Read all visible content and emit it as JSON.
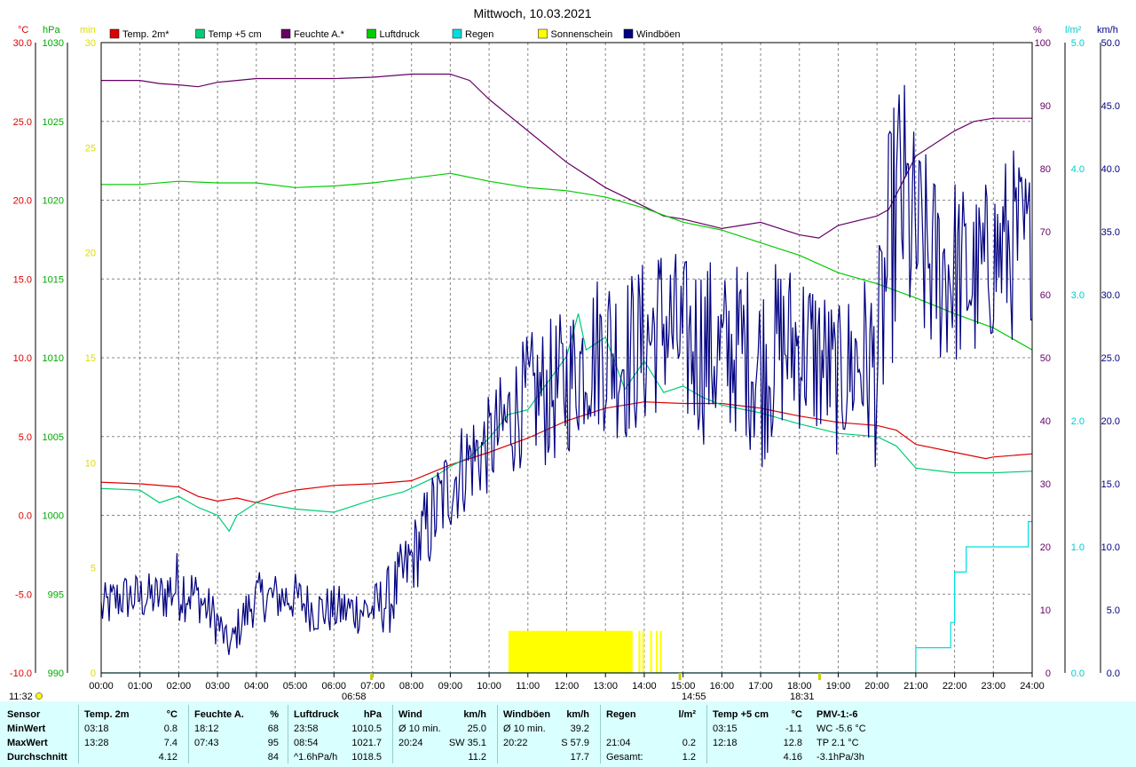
{
  "title": "Mittwoch, 10.03.2021",
  "axes": {
    "temp_unit": "°C",
    "pressure_unit": "hPa",
    "sun_unit": "min",
    "humidity_unit": "%",
    "rain_unit": "l/m²",
    "wind_unit": "km/h",
    "temp_ticks": [
      "30.0",
      "25.0",
      "20.0",
      "15.0",
      "10.0",
      "5.0",
      "0.0",
      "-5.0",
      "-10.0"
    ],
    "pressure_ticks": [
      "1030",
      "1025",
      "1020",
      "1015",
      "1010",
      "1005",
      "1000",
      "995",
      "990"
    ],
    "sun_ticks": [
      "30",
      "25",
      "20",
      "15",
      "10",
      "5",
      "0"
    ],
    "humidity_ticks": [
      "100",
      "90",
      "80",
      "70",
      "60",
      "50",
      "40",
      "30",
      "20",
      "10",
      "0"
    ],
    "rain_ticks": [
      "5.0",
      "4.0",
      "3.0",
      "2.0",
      "1.0",
      "0.0"
    ],
    "wind_ticks": [
      "50.0",
      "45.0",
      "40.0",
      "35.0",
      "30.0",
      "25.0",
      "20.0",
      "15.0",
      "10.0",
      "5.0",
      "0.0"
    ],
    "x_ticks": [
      "00:00",
      "01:00",
      "02:00",
      "03:00",
      "04:00",
      "05:00",
      "06:00",
      "07:00",
      "08:00",
      "09:00",
      "10:00",
      "11:00",
      "12:00",
      "13:00",
      "14:00",
      "15:00",
      "16:00",
      "17:00",
      "18:00",
      "19:00",
      "20:00",
      "21:00",
      "22:00",
      "23:00",
      "24:00"
    ]
  },
  "legend": [
    {
      "label": "Temp. 2m*",
      "color": "#dd0000"
    },
    {
      "label": "Temp +5 cm",
      "color": "#00cc77"
    },
    {
      "label": "Feuchte A.*",
      "color": "#660066"
    },
    {
      "label": "Luftdruck",
      "color": "#00cc00"
    },
    {
      "label": "Regen",
      "color": "#00dddd"
    },
    {
      "label": "Sonnenschein",
      "color": "#ffff00"
    },
    {
      "label": "Windböen",
      "color": "#000080"
    }
  ],
  "markers": {
    "corner_time": "11:32",
    "sunrise": "06:58",
    "noon": "14:55",
    "sunset": "18:31"
  },
  "chart_data": {
    "type": "line",
    "x_unit": "hour",
    "xlim": [
      0,
      24
    ],
    "series": [
      {
        "name": "Temp. 2m*",
        "axis": "temp",
        "ylim": [
          -10,
          30
        ],
        "color": "#dd0000",
        "x": [
          0,
          1,
          2,
          2.5,
          3,
          3.5,
          4,
          4.5,
          5,
          6,
          7,
          8,
          9,
          10,
          11,
          12,
          13,
          14,
          15,
          16,
          17,
          18,
          19,
          20,
          20.5,
          21,
          22,
          22.8,
          23,
          24
        ],
        "y": [
          2.1,
          2.0,
          1.8,
          1.2,
          0.9,
          1.1,
          0.8,
          1.3,
          1.6,
          1.9,
          2.0,
          2.2,
          3.2,
          4.0,
          4.9,
          6.0,
          6.8,
          7.2,
          7.1,
          7.1,
          6.8,
          6.3,
          5.9,
          5.7,
          5.4,
          4.5,
          4.0,
          3.6,
          3.7,
          3.9
        ]
      },
      {
        "name": "Temp +5 cm",
        "axis": "temp",
        "ylim": [
          -10,
          30
        ],
        "color": "#00cc77",
        "x": [
          0,
          1,
          1.5,
          2,
          2.5,
          3,
          3.3,
          3.5,
          4,
          5,
          6,
          7,
          7.8,
          8.5,
          9,
          9.5,
          10,
          10.5,
          11,
          11.5,
          12,
          12.3,
          12.5,
          13,
          13.5,
          14,
          14.5,
          15,
          15.5,
          16,
          17,
          18,
          19,
          20,
          20.5,
          21,
          22,
          23,
          24
        ],
        "y": [
          1.7,
          1.6,
          0.8,
          1.2,
          0.5,
          0,
          -1.0,
          0,
          0.8,
          0.4,
          0.2,
          1.0,
          1.5,
          2.3,
          3.1,
          3.7,
          4.9,
          6.4,
          6.7,
          8.4,
          10.1,
          12.8,
          10.5,
          11.3,
          8.0,
          9.8,
          7.8,
          8.2,
          7.5,
          7.0,
          6.5,
          5.8,
          5.2,
          5.0,
          4.4,
          3.0,
          2.7,
          2.7,
          2.8
        ]
      },
      {
        "name": "Feuchte A.*",
        "axis": "humidity",
        "ylim": [
          0,
          100
        ],
        "color": "#660066",
        "x": [
          0,
          1,
          1.5,
          2,
          2.5,
          3,
          3.5,
          4,
          5,
          6,
          7,
          8,
          9,
          9.5,
          10,
          11,
          12,
          13,
          14,
          14.5,
          15,
          16,
          16.5,
          17,
          18,
          18.5,
          19,
          20,
          20.3,
          21,
          22,
          22.5,
          23,
          24
        ],
        "y": [
          94,
          94,
          93.5,
          93.3,
          93,
          93.7,
          94,
          94.3,
          94.3,
          94.3,
          94.5,
          95,
          95,
          94,
          91,
          86,
          81,
          77,
          74,
          72.5,
          72,
          70.5,
          71,
          71.5,
          69.5,
          69,
          71,
          72.5,
          73.5,
          82,
          86,
          87.5,
          88,
          88
        ]
      },
      {
        "name": "Luftdruck",
        "axis": "pressure",
        "ylim": [
          990,
          1030
        ],
        "color": "#00cc00",
        "x": [
          0,
          1,
          2,
          3,
          4,
          5,
          6,
          7,
          8,
          9,
          10,
          11,
          12,
          13,
          14,
          15,
          16,
          17,
          18,
          19,
          20,
          21,
          22,
          23,
          24
        ],
        "y": [
          1021.0,
          1021.0,
          1021.2,
          1021.1,
          1021.1,
          1020.8,
          1020.9,
          1021.1,
          1021.4,
          1021.7,
          1021.2,
          1020.8,
          1020.6,
          1020.2,
          1019.5,
          1018.6,
          1018.1,
          1017.3,
          1016.5,
          1015.4,
          1014.7,
          1013.8,
          1012.8,
          1011.9,
          1010.5
        ]
      },
      {
        "name": "Regen",
        "axis": "rain",
        "ylim": [
          0,
          5
        ],
        "color": "#00dddd",
        "step": true,
        "x": [
          0,
          20.9,
          21,
          21.8,
          21.9,
          22.0,
          22.3,
          22.7,
          23.9,
          24
        ],
        "y": [
          0,
          0,
          0.2,
          0.2,
          0.4,
          0.8,
          1.0,
          1.0,
          1.2,
          1.2
        ]
      },
      {
        "name": "Windböen",
        "axis": "wind",
        "ylim": [
          0,
          50
        ],
        "color": "#000080",
        "noise": true,
        "x": [
          0,
          0.5,
          1,
          1.5,
          2,
          2.5,
          3,
          3.3,
          3.6,
          4,
          4.5,
          5,
          5.5,
          6,
          6.5,
          7,
          7.5,
          8,
          8.5,
          9,
          9.5,
          10,
          10.5,
          11,
          11.5,
          12,
          12.5,
          13,
          13.5,
          14,
          14.5,
          15,
          15.5,
          16,
          16.5,
          17,
          17.5,
          18,
          18.5,
          19,
          19.5,
          20,
          20.3,
          20.6,
          21,
          21.5,
          22,
          22.5,
          23,
          23.5,
          24
        ],
        "y": [
          5,
          6,
          6,
          6,
          7,
          6,
          4,
          2,
          4,
          6,
          6,
          6,
          5,
          5,
          5,
          5,
          6,
          9,
          12,
          15,
          17,
          18,
          20,
          22,
          22,
          23,
          25,
          26,
          25,
          26,
          28,
          26,
          26,
          25,
          26,
          24,
          26,
          26,
          25,
          23,
          25,
          24,
          33,
          38,
          34,
          32,
          32,
          31,
          33,
          34,
          34
        ],
        "amp": [
          2,
          2,
          2,
          2,
          3,
          2,
          2,
          1,
          2,
          2,
          2,
          2,
          2,
          2,
          2,
          2,
          3,
          3,
          4,
          4,
          4,
          4,
          5,
          5,
          6,
          6,
          6,
          7,
          7,
          7,
          7,
          7,
          8,
          7,
          7,
          8,
          7,
          7,
          7,
          6,
          7,
          8,
          10,
          11,
          9,
          8,
          8,
          7,
          7,
          8,
          6
        ]
      }
    ],
    "sunshine": {
      "axis": "sun",
      "ylim": [
        0,
        30
      ],
      "color": "#ffff00",
      "bars": [
        [
          10.5,
          13.7,
          2
        ],
        [
          13.85,
          13.9,
          2
        ],
        [
          13.95,
          14.0,
          2
        ],
        [
          14.15,
          14.2,
          2
        ],
        [
          14.3,
          14.35,
          2
        ],
        [
          14.4,
          14.45,
          2
        ]
      ]
    }
  },
  "stats": {
    "sensor": {
      "header": "Sensor",
      "rows": [
        "MinWert",
        "MaxWert",
        "Durchschnitt"
      ]
    },
    "temp2m": {
      "header": "Temp. 2m",
      "unit": "°C",
      "rows": [
        [
          "03:18",
          "0.8"
        ],
        [
          "13:28",
          "7.4"
        ],
        [
          "",
          "4.12"
        ]
      ]
    },
    "humidity": {
      "header": "Feuchte A.",
      "unit": "%",
      "rows": [
        [
          "18:12",
          "68"
        ],
        [
          "07:43",
          "95"
        ],
        [
          "",
          "84"
        ]
      ]
    },
    "pressure": {
      "header": "Luftdruck",
      "unit": "hPa",
      "rows": [
        [
          "23:58",
          "1010.5"
        ],
        [
          "08:54",
          "1021.7"
        ],
        [
          "^1.6hPa/h",
          "1018.5"
        ]
      ]
    },
    "wind": {
      "header": "Wind",
      "unit": "km/h",
      "rows": [
        [
          "Ø 10 min.",
          "25.0"
        ],
        [
          "20:24",
          "SW 35.1"
        ],
        [
          "",
          "11.2"
        ]
      ]
    },
    "gusts": {
      "header": "Windböen",
      "unit": "km/h",
      "rows": [
        [
          "Ø 10 min.",
          "39.2"
        ],
        [
          "20:22",
          "S 57.9"
        ],
        [
          "",
          "17.7"
        ]
      ]
    },
    "rain": {
      "header": "Regen",
      "unit": "l/m²",
      "rows": [
        [
          "",
          ""
        ],
        [
          "21:04",
          "0.2"
        ],
        [
          "Gesamt:",
          "1.2"
        ]
      ]
    },
    "temp5cm": {
      "header": "Temp +5 cm",
      "unit": "°C",
      "rows": [
        [
          "03:15",
          "-1.1"
        ],
        [
          "12:18",
          "12.8"
        ],
        [
          "",
          "4.16"
        ]
      ]
    },
    "pmv": {
      "header": "PMV-1:-6",
      "rows": [
        "WC -5.6 °C",
        "TP 2.1 °C",
        "-3.1hPa/3h"
      ]
    }
  }
}
